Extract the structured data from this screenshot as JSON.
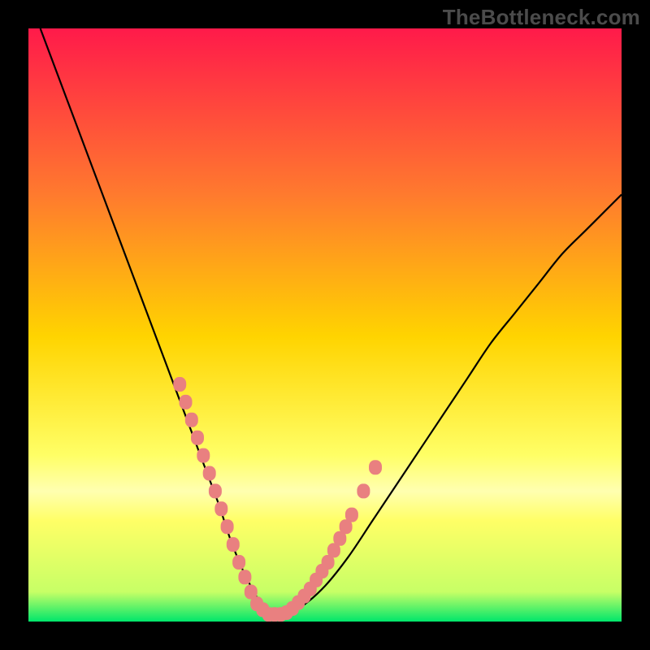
{
  "watermark": "TheBottleneck.com",
  "colors": {
    "frame": "#000000",
    "gradient_top": "#ff1a4a",
    "gradient_mid_upper": "#ff7a2e",
    "gradient_mid": "#ffd400",
    "gradient_mid_lower": "#ffff66",
    "gradient_band": "#ffffb0",
    "gradient_bottom": "#00e66b",
    "curve": "#000000",
    "markers": "#e98080"
  },
  "chart_data": {
    "type": "line",
    "title": "",
    "xlabel": "",
    "ylabel": "",
    "xlim": [
      0,
      100
    ],
    "ylim": [
      0,
      100
    ],
    "series": [
      {
        "name": "bottleneck-curve",
        "x": [
          2,
          5,
          8,
          11,
          14,
          17,
          20,
          23,
          26,
          29,
          32,
          34,
          36,
          38,
          39.5,
          41,
          43,
          46,
          50,
          54,
          58,
          62,
          66,
          70,
          74,
          78,
          82,
          86,
          90,
          94,
          98,
          100
        ],
        "y": [
          100,
          92,
          84,
          76,
          68,
          60,
          52,
          44,
          36,
          28,
          20,
          14,
          9,
          5,
          2.5,
          1.2,
          1.2,
          2.5,
          6,
          11,
          17,
          23,
          29,
          35,
          41,
          47,
          52,
          57,
          62,
          66,
          70,
          72
        ]
      }
    ],
    "markers": {
      "name": "highlighted-points",
      "points": [
        {
          "x": 25.5,
          "y": 40
        },
        {
          "x": 26.5,
          "y": 37
        },
        {
          "x": 27.5,
          "y": 34
        },
        {
          "x": 28.5,
          "y": 31
        },
        {
          "x": 29.5,
          "y": 28
        },
        {
          "x": 30.5,
          "y": 25
        },
        {
          "x": 31.5,
          "y": 22
        },
        {
          "x": 32.5,
          "y": 19
        },
        {
          "x": 33.5,
          "y": 16
        },
        {
          "x": 34.5,
          "y": 13
        },
        {
          "x": 35.5,
          "y": 10
        },
        {
          "x": 36.5,
          "y": 7.5
        },
        {
          "x": 37.5,
          "y": 5
        },
        {
          "x": 38.5,
          "y": 3
        },
        {
          "x": 39.5,
          "y": 2
        },
        {
          "x": 40.5,
          "y": 1.2
        },
        {
          "x": 41.5,
          "y": 1.2
        },
        {
          "x": 42.5,
          "y": 1.2
        },
        {
          "x": 43.5,
          "y": 1.5
        },
        {
          "x": 44.5,
          "y": 2.2
        },
        {
          "x": 45.5,
          "y": 3.2
        },
        {
          "x": 46.5,
          "y": 4.3
        },
        {
          "x": 47.5,
          "y": 5.5
        },
        {
          "x": 48.5,
          "y": 7
        },
        {
          "x": 49.5,
          "y": 8.5
        },
        {
          "x": 50.5,
          "y": 10
        },
        {
          "x": 51.5,
          "y": 12
        },
        {
          "x": 52.5,
          "y": 14
        },
        {
          "x": 53.5,
          "y": 16
        },
        {
          "x": 54.5,
          "y": 18
        },
        {
          "x": 56.5,
          "y": 22
        },
        {
          "x": 58.5,
          "y": 26
        }
      ]
    }
  }
}
